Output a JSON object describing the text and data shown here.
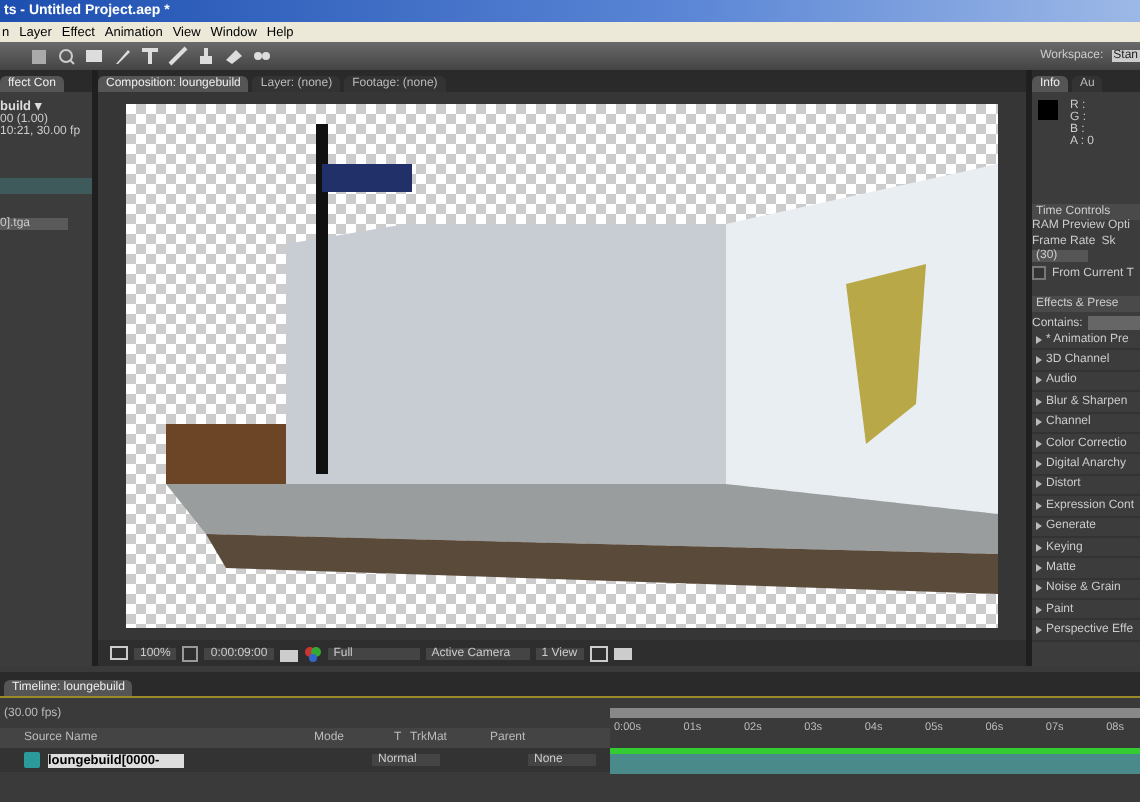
{
  "window": {
    "title": "ts - Untitled Project.aep *"
  },
  "menu": [
    "n",
    "Layer",
    "Effect",
    "Animation",
    "View",
    "Window",
    "Help"
  ],
  "toolbar": {
    "workspace_label": "Workspace:",
    "workspace_value": "Stan"
  },
  "left_panel": {
    "tab": {
      "label": "ffect Con",
      "selected": true
    },
    "comp_name": "build ▾",
    "duration": "00 (1.00)",
    "info": "10:21, 30.00 fp",
    "item": "0].tga"
  },
  "viewer": {
    "tabs": [
      {
        "label": "Composition: loungebuild",
        "selected": true
      },
      {
        "label": "Layer: (none)",
        "selected": false
      },
      {
        "label": "Footage: (none)",
        "selected": false
      }
    ],
    "zoom": "100%",
    "timecode": "0:00:09:00",
    "resolution": "Full",
    "camera": "Active Camera",
    "views": "1 View"
  },
  "right_panel": {
    "tabs": [
      {
        "label": "Info",
        "selected": true
      },
      {
        "label": "Au",
        "selected": false
      }
    ],
    "channels": [
      "R :",
      "G :",
      "B :",
      "A : 0"
    ],
    "time_controls": "Time Controls",
    "ram_preview": "RAM Preview Opti",
    "frame_rate_label": "Frame Rate",
    "skip_label": "Sk",
    "frame_rate": "(30)",
    "from_current": {
      "label": "From Current T",
      "checked": false
    },
    "effects_title": "Effects & Prese",
    "contains_label": "Contains:",
    "effects": [
      "* Animation Pre",
      "3D Channel",
      "Audio",
      "Blur & Sharpen",
      "Channel",
      "Color Correctio",
      "Digital Anarchy",
      "Distort",
      "Expression Cont",
      "Generate",
      "Keying",
      "Matte",
      "Noise & Grain",
      "Paint",
      "Perspective Effe"
    ]
  },
  "timeline": {
    "tab": "Timeline: loungebuild",
    "fps": "(30.00 fps)",
    "columns": [
      "Source Name",
      "Mode",
      "T",
      "TrkMat",
      "Parent"
    ],
    "layer": {
      "name": "loungebuild[0000-",
      "mode": "Normal",
      "parent": "None"
    },
    "ruler": [
      "0:00s",
      "01s",
      "02s",
      "03s",
      "04s",
      "05s",
      "06s",
      "07s",
      "08s"
    ]
  }
}
